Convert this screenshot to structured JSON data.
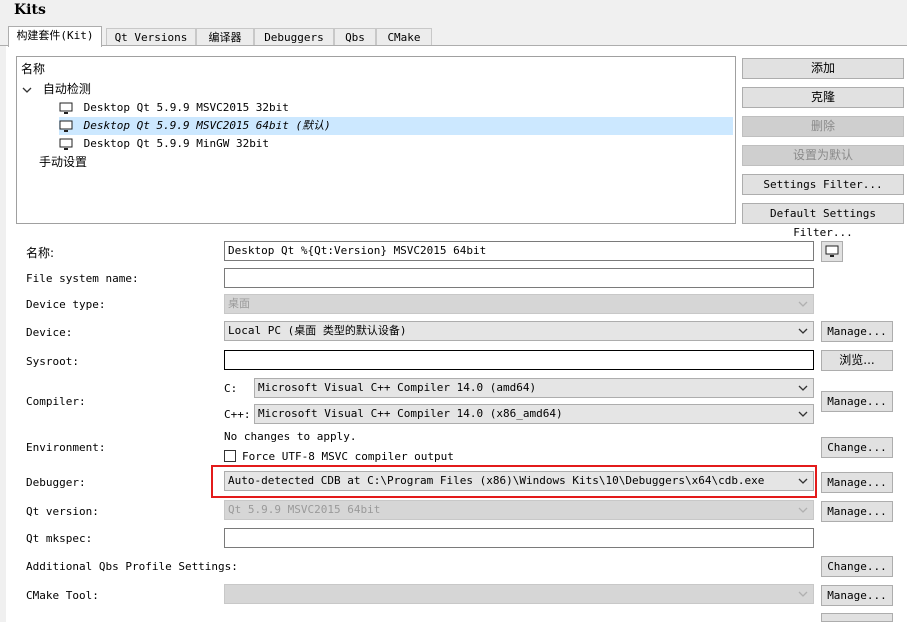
{
  "window": {
    "title": "Kits"
  },
  "tabs": [
    {
      "label": "构建套件(Kit)",
      "active": true
    },
    {
      "label": "Qt Versions"
    },
    {
      "label": "编译器"
    },
    {
      "label": "Debuggers"
    },
    {
      "label": "Qbs"
    },
    {
      "label": "CMake"
    }
  ],
  "tree": {
    "header": "名称",
    "auto_group": "自动检测",
    "items": [
      "Desktop Qt 5.9.9 MSVC2015 32bit",
      "Desktop Qt 5.9.9 MSVC2015 64bit (默认)",
      "Desktop Qt 5.9.9 MinGW 32bit"
    ],
    "manual_group": "手动设置"
  },
  "side_buttons": {
    "add": "添加",
    "clone": "克隆",
    "delete": "删除",
    "set_default": "设置为默认",
    "settings_filter": "Settings Filter...",
    "default_settings_filter": "Default Settings Filter..."
  },
  "form": {
    "name": {
      "label": "名称:",
      "value": "Desktop Qt %{Qt:Version} MSVC2015 64bit"
    },
    "file_system_name": {
      "label": "File system name:",
      "value": ""
    },
    "device_type": {
      "label": "Device type:",
      "value": "桌面"
    },
    "device": {
      "label": "Device:",
      "value": "Local PC (桌面 类型的默认设备)",
      "button": "Manage..."
    },
    "sysroot": {
      "label": "Sysroot:",
      "value": "",
      "button": "浏览..."
    },
    "compiler": {
      "label": "Compiler:",
      "c_label": "C:",
      "c_value": "Microsoft Visual C++ Compiler 14.0 (amd64)",
      "cpp_label": "C++:",
      "cpp_value": "Microsoft Visual C++ Compiler 14.0 (x86_amd64)",
      "button": "Manage..."
    },
    "environment": {
      "label": "Environment:",
      "status": "No changes to apply.",
      "checkbox_label": "Force UTF-8 MSVC compiler output",
      "checked": false,
      "button": "Change..."
    },
    "debugger": {
      "label": "Debugger:",
      "value": "Auto-detected CDB at C:\\Program Files (x86)\\Windows Kits\\10\\Debuggers\\x64\\cdb.exe",
      "button": "Manage..."
    },
    "qt_version": {
      "label": "Qt version:",
      "value": "Qt 5.9.9 MSVC2015 64bit",
      "button": "Manage..."
    },
    "qt_mkspec": {
      "label": "Qt mkspec:",
      "value": ""
    },
    "qbs_profile": {
      "label": "Additional Qbs Profile Settings:",
      "button": "Change..."
    },
    "cmake_tool": {
      "label": "CMake Tool:",
      "value": "",
      "button": "Manage..."
    }
  },
  "colors": {
    "selection": "#cce8ff",
    "highlight_border": "#e31b1b"
  }
}
